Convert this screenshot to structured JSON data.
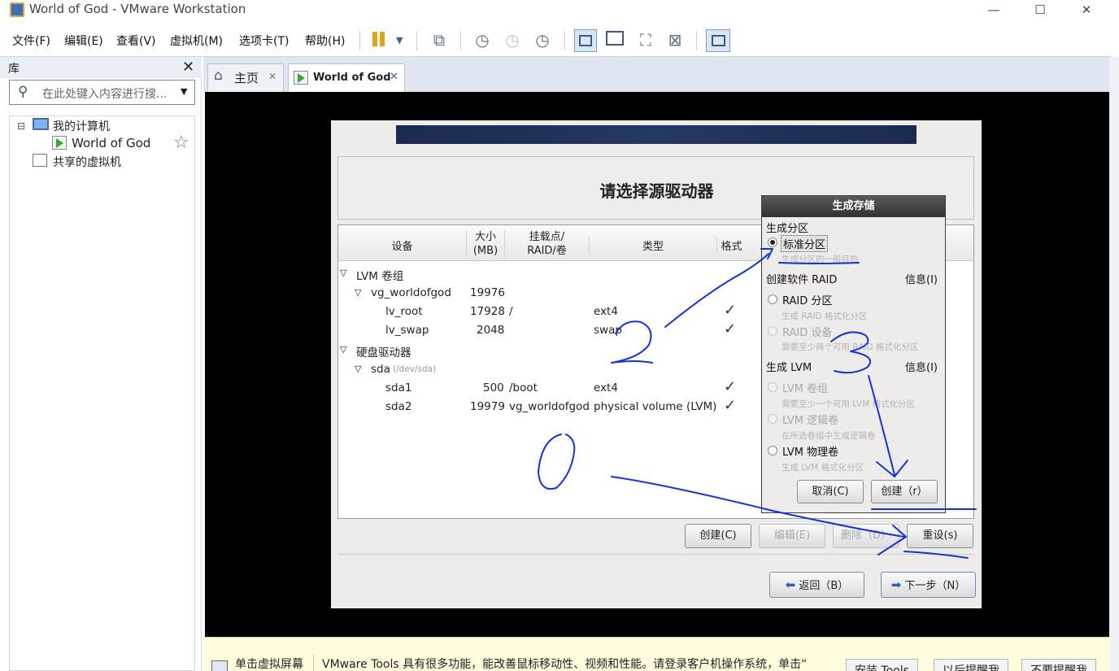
{
  "window": {
    "title": "World of God - VMware Workstation",
    "controls": [
      "—",
      "☐",
      "✕"
    ]
  },
  "menu": [
    "文件(F)",
    "编辑(E)",
    "查看(V)",
    "虚拟机(M)",
    "选项卡(T)",
    "帮助(H)"
  ],
  "library": {
    "title": "库",
    "close": "✕",
    "search_placeholder": "在此处键入内容进行搜...",
    "tree": {
      "collapse": "⊟",
      "my_computer": "我的计算机",
      "vm": "World of God",
      "shared": "共享的虚拟机"
    }
  },
  "tabs": [
    {
      "label": "主页",
      "close": "✕"
    },
    {
      "label": "World of God",
      "close": "✕"
    }
  ],
  "installer": {
    "heading": "请选择源驱动器",
    "columns": [
      "设备",
      "大小\n(MB)",
      "挂载点/\nRAID/卷",
      "类型",
      "格式"
    ],
    "rows": [
      {
        "device": "LVM 卷组",
        "size": "",
        "mount": "",
        "type": "",
        "format": ""
      },
      {
        "device": "vg_worldofgod",
        "size": "19976",
        "mount": "",
        "type": "",
        "format": ""
      },
      {
        "device": "lv_root",
        "size": "17928",
        "mount": "/",
        "type": "ext4",
        "format": "✓"
      },
      {
        "device": "lv_swap",
        "size": "2048",
        "mount": "",
        "type": "swap",
        "format": "✓"
      },
      {
        "device": "硬盘驱动器",
        "size": "",
        "mount": "",
        "type": "",
        "format": ""
      },
      {
        "device": "sda",
        "sub": "(/dev/sda)",
        "size": "",
        "mount": "",
        "type": "",
        "format": ""
      },
      {
        "device": "sda1",
        "size": "500",
        "mount": "/boot",
        "type": "ext4",
        "format": "✓"
      },
      {
        "device": "sda2",
        "size": "19979",
        "mount": "vg_worldofgod",
        "type": "physical volume (LVM)",
        "format": "✓"
      }
    ],
    "buttons": {
      "create": "创建(C)",
      "edit": "编辑(E)",
      "delete": "删除（D）",
      "reset": "重设(s)",
      "back": "返回（B）",
      "next": "下一步（N）"
    }
  },
  "dialog": {
    "title": "生成存储",
    "section_partition": "生成分区",
    "std_label": "标准分区",
    "std_sub": "生成分区的一般目的",
    "section_raid": "创建软件 RAID",
    "info": "信息(I)",
    "raid_part": "RAID 分区",
    "raid_part_sub": "生成 RAID 格式化分区",
    "raid_dev": "RAID 设备",
    "raid_dev_sub": "需要至少两个可用 RAID 格式化分区",
    "section_lvm": "生成 LVM",
    "lvm_vg": "LVM 卷组",
    "lvm_vg_sub": "需要至少一个可用 LVM 格式化分区",
    "lvm_lv": "LVM 逻辑卷",
    "lvm_lv_sub": "在所选卷组中生成逻辑卷",
    "lvm_pv": "LVM 物理卷",
    "lvm_pv_sub": "生成 LVM 格式化分区",
    "cancel": "取消(C)",
    "create": "创建（r）"
  },
  "bottom_bar": {
    "click_hint": "单击虚拟屏幕",
    "message": "VMware Tools 具有很多功能，能改善鼠标移动性、视频和性能。请登录客户机操作系统，单击“",
    "btn_install": "安装 Tools",
    "btn_later": "以后提醒我",
    "btn_never": "不要提醒我"
  },
  "icons": [
    "search-icon",
    "computer-icon",
    "vm-icon",
    "shared-vm-icon",
    "star-icon",
    "home-icon",
    "pause-icon",
    "snapshot-icon",
    "fullscreen-icon",
    "back-arrow-icon",
    "next-arrow-icon"
  ],
  "colors": {
    "accent": "#2f5fb0",
    "ink": "#1432d8",
    "dialog_title": "#3a3a3a",
    "banner": "#1b2a50"
  }
}
